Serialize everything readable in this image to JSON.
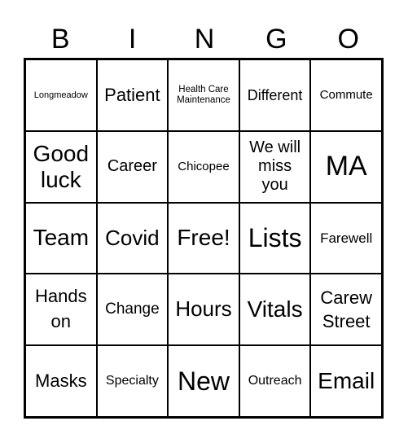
{
  "header": [
    "B",
    "I",
    "N",
    "G",
    "O"
  ],
  "cells": [
    "Longmeadow",
    "Patient",
    "Health Care Maintenance",
    "Different",
    "Commute",
    "Good luck",
    "Career",
    "Chicopee",
    "We will miss you",
    "MA",
    "Team",
    "Covid",
    "Free!",
    "Lists",
    "Farewell",
    "Hands on",
    "Change",
    "Hours",
    "Vitals",
    "Carew Street",
    "Masks",
    "Specialty",
    "New",
    "Outreach",
    "Email"
  ]
}
